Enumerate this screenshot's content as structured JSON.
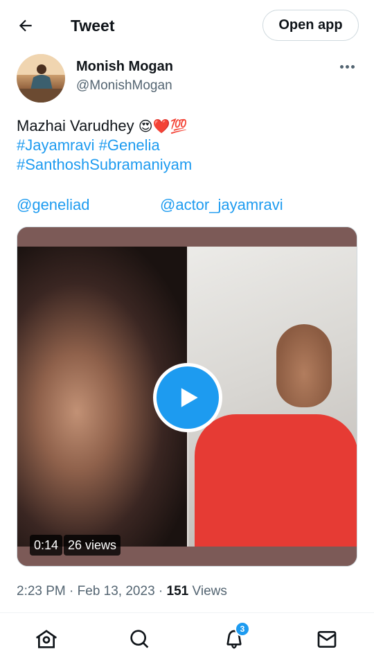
{
  "header": {
    "title": "Tweet",
    "open_app_label": "Open app",
    "back_icon": "arrow-left-icon"
  },
  "author": {
    "display_name": "Monish Mogan",
    "handle": "@MonishMogan",
    "more_icon": "more-horizontal-icon"
  },
  "tweet": {
    "text": "Mazhai Varudhey ",
    "emojis": "😍❤️💯",
    "hashtags_line1": [
      "#Jayamravi",
      "#Genelia"
    ],
    "hashtags_line2": [
      "#SanthoshSubramaniyam"
    ],
    "mentions": [
      "@geneliad",
      "@actor_jayamravi"
    ]
  },
  "video": {
    "duration": "0:14",
    "views": "26 views",
    "play_icon": "play-icon"
  },
  "meta": {
    "time": "2:23 PM",
    "separator": " · ",
    "date": "Feb 13, 2023",
    "view_count": "151",
    "view_label": " Views"
  },
  "nav": {
    "items": [
      {
        "name": "home",
        "icon": "home-icon"
      },
      {
        "name": "search",
        "icon": "search-icon"
      },
      {
        "name": "notifications",
        "icon": "bell-icon",
        "badge": "3"
      },
      {
        "name": "messages",
        "icon": "mail-icon"
      }
    ]
  },
  "colors": {
    "accent": "#1d9bf0",
    "text": "#0f1419",
    "secondary": "#536471"
  }
}
